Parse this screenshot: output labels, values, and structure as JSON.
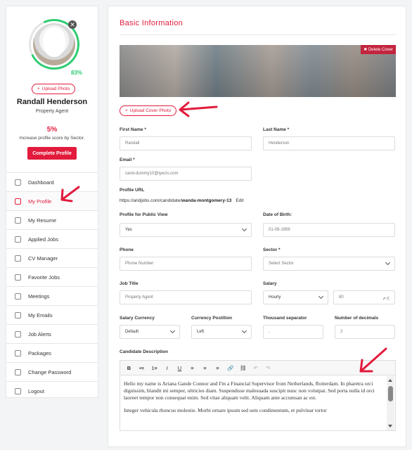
{
  "sidebar": {
    "profile_completion": "83%",
    "upload_photo_label": "Upload Photo",
    "name": "Randall Henderson",
    "role": "Property Agent",
    "score_pct": "5%",
    "score_text": "Increase profile score by Sector.",
    "complete_profile_label": "Complete Profile",
    "menu": [
      {
        "label": "Dashboard",
        "icon": "dashboard-icon"
      },
      {
        "label": "My Profile",
        "icon": "user-icon",
        "active": true
      },
      {
        "label": "My Resume",
        "icon": "resume-icon"
      },
      {
        "label": "Applied Jobs",
        "icon": "briefcase-icon"
      },
      {
        "label": "CV Manager",
        "icon": "cv-icon"
      },
      {
        "label": "Favorite Jobs",
        "icon": "heart-icon"
      },
      {
        "label": "Meetings",
        "icon": "bell-icon"
      },
      {
        "label": "My Emails",
        "icon": "mail-icon"
      },
      {
        "label": "Job Alerts",
        "icon": "alert-icon"
      },
      {
        "label": "Packages",
        "icon": "package-icon"
      },
      {
        "label": "Change Password",
        "icon": "lock-icon"
      },
      {
        "label": "Logout",
        "icon": "logout-icon"
      }
    ]
  },
  "main": {
    "title": "Basic Information",
    "delete_cover_label": "✖ Delete Cover",
    "upload_cover_label": "Upload Cover Photo",
    "fields": {
      "first_name": {
        "label": "First Name *",
        "value": "Randall"
      },
      "last_name": {
        "label": "Last Name *",
        "value": "Henderson"
      },
      "email": {
        "label": "Email *",
        "value": "cand-dummy10@iyecis.com"
      },
      "profile_url": {
        "label": "Profile URL",
        "prefix": "https://aridjobs.com/candidate/",
        "slug": "wanda-montgomery-13",
        "edit": "Edit"
      },
      "public_view": {
        "label": "Profile for Public View",
        "value": "Yes"
      },
      "dob": {
        "label": "Date of Birth:",
        "value": "01-09-1959"
      },
      "phone": {
        "label": "Phone",
        "placeholder": "Phone Number"
      },
      "sector": {
        "label": "Sector *",
        "value": "Select Sector"
      },
      "job_title": {
        "label": "Job Title",
        "value": "Property Agent"
      },
      "salary": {
        "label": "Salary",
        "period": "Hourly",
        "amount": "80",
        "currency_symbol": "ج.م"
      },
      "salary_currency": {
        "label": "Salary Currency",
        "value": "Default"
      },
      "currency_position": {
        "label": "Currency Postition",
        "value": "Left"
      },
      "thousand_sep": {
        "label": "Thousand separator",
        "value": ","
      },
      "decimals": {
        "label": "Number of decimals",
        "value": "2"
      },
      "description": {
        "label": "Candidate Description",
        "paragraphs": [
          "Hello my name is Ariana Gande Connor and I'm a Financial Supervisor from Netherlands, Rotterdam. In pharetra orci dignissim, blandit mi semper, ultricies diam. Suspendisse malesuada suscipit nunc non volutpat. Sed porta nulla id orci laoreet tempor non consequat enim. Sed vitae aliquam velit. Aliquam ante accumsan ac est.",
          "Integer vehicula rhoncus molestie. Morbi ornare ipsum sed sem condimentum, et pulvinar tortor"
        ]
      }
    },
    "toolbar": [
      "B",
      "•≡",
      "1≡",
      "I",
      "U",
      "≡",
      "≡",
      "≡",
      "🔗",
      "⛓",
      "↶",
      "↷"
    ]
  },
  "colors": {
    "accent": "#e21b3c",
    "progress": "#2ecc71"
  }
}
